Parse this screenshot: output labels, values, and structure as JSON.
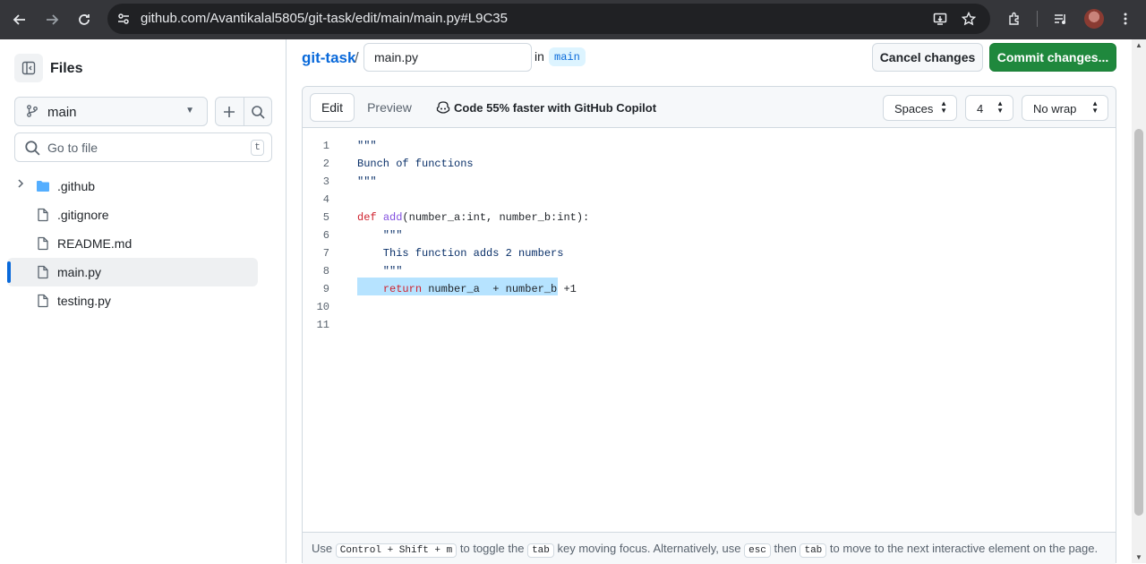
{
  "browser": {
    "url": "github.com/Avantikalal5805/git-task/edit/main/main.py#L9C35"
  },
  "sidebar": {
    "title": "Files",
    "branch": "main",
    "goto_placeholder": "Go to file",
    "goto_shortcut": "t",
    "items": [
      {
        "name": ".github",
        "type": "folder"
      },
      {
        "name": ".gitignore",
        "type": "file"
      },
      {
        "name": "README.md",
        "type": "file"
      },
      {
        "name": "main.py",
        "type": "file",
        "active": true
      },
      {
        "name": "testing.py",
        "type": "file"
      }
    ]
  },
  "header": {
    "repo": "git-task",
    "separator": "/",
    "filename": "main.py",
    "in_label": "in",
    "branch": "main",
    "cancel_label": "Cancel changes",
    "commit_label": "Commit changes..."
  },
  "editor": {
    "tab_edit": "Edit",
    "tab_preview": "Preview",
    "copilot_text": "Code 55% faster with GitHub Copilot",
    "indent_mode": "Spaces",
    "indent_size": "4",
    "wrap_mode": "No wrap",
    "line_numbers": [
      "1",
      "2",
      "3",
      "4",
      "5",
      "6",
      "7",
      "8",
      "9",
      "10",
      "11"
    ],
    "lines": [
      "\"\"\"",
      "Bunch of functions",
      "\"\"\"",
      "",
      "def add(number_a:int, number_b:int):",
      "    \"\"\"",
      "    This function adds 2 numbers",
      "    \"\"\"",
      "    return number_a  + number_b +1",
      "",
      ""
    ],
    "highlighted_line": 9
  },
  "footer": {
    "t1": "Use",
    "k1": "Control",
    "plus1": "+",
    "k2": "Shift",
    "plus2": "+",
    "k3": "m",
    "t2": "to toggle the",
    "k4": "tab",
    "t3": "key moving focus. Alternatively, use",
    "k5": "esc",
    "t4": "then",
    "k6": "tab",
    "t5": "to move to the next interactive element on the page."
  },
  "colors": {
    "accent": "#0969da",
    "commit_green": "#1f883d",
    "highlight": "#b6e3ff"
  }
}
